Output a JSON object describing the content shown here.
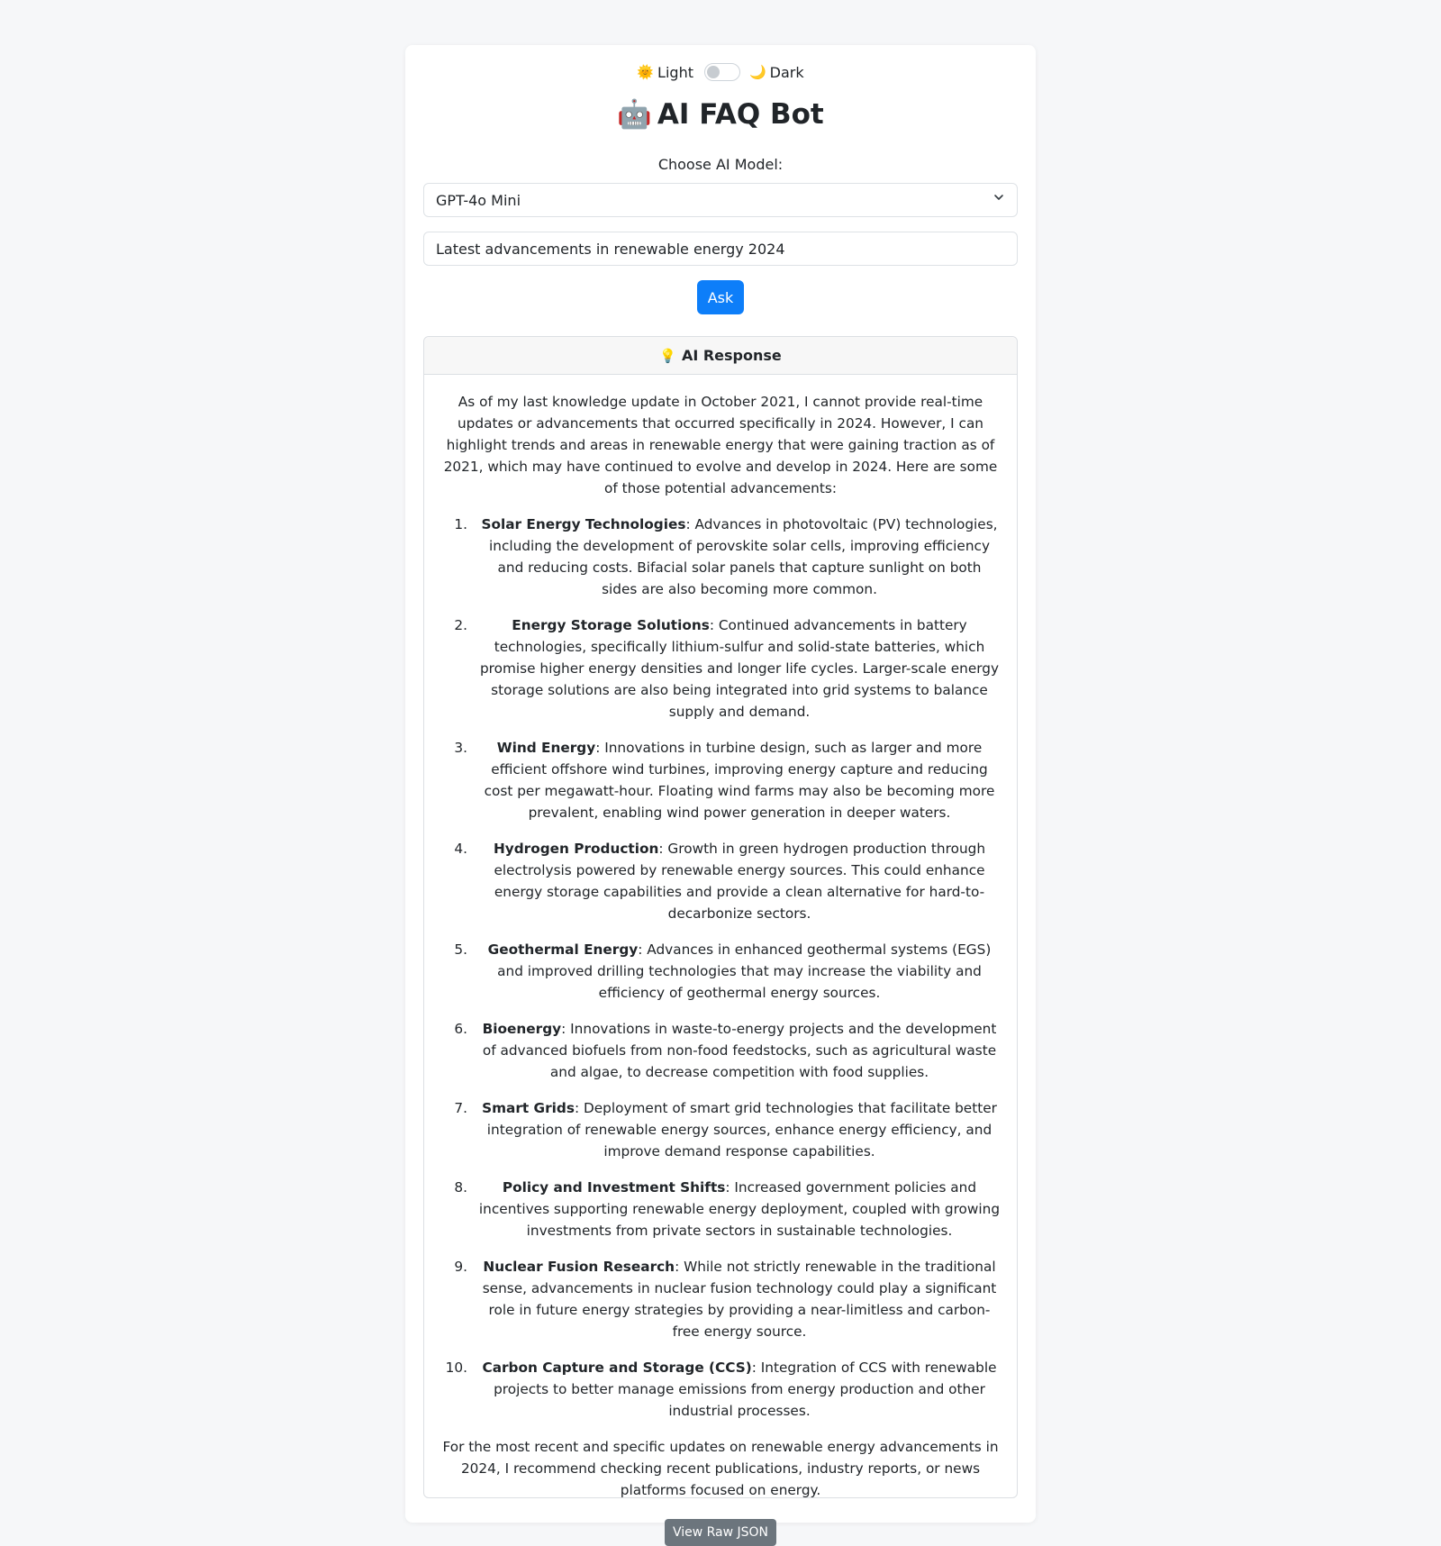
{
  "theme": {
    "light_icon": "🌞",
    "light_label": "Light",
    "dark_icon": "🌙",
    "dark_label": "Dark",
    "is_dark": false
  },
  "header": {
    "icon": "🤖",
    "title": "AI FAQ Bot"
  },
  "model": {
    "label": "Choose AI Model:",
    "selected": "GPT-4o Mini"
  },
  "query": {
    "value": "Latest advancements in renewable energy 2024"
  },
  "ask_label": "Ask",
  "response": {
    "header_icon": "💡",
    "header_label": "AI Response",
    "intro": "As of my last knowledge update in October 2021, I cannot provide real-time updates or advancements that occurred specifically in 2024. However, I can highlight trends and areas in renewable energy that were gaining traction as of 2021, which may have continued to evolve and develop in 2024. Here are some of those potential advancements:",
    "items": [
      {
        "num": "1.",
        "title": "Solar Energy Technologies",
        "text": ": Advances in photovoltaic (PV) technologies, including the development of perovskite solar cells, improving efficiency and reducing costs. Bifacial solar panels that capture sunlight on both sides are also becoming more common."
      },
      {
        "num": "2.",
        "title": "Energy Storage Solutions",
        "text": ": Continued advancements in battery technologies, specifically lithium-sulfur and solid-state batteries, which promise higher energy densities and longer life cycles. Larger-scale energy storage solutions are also being integrated into grid systems to balance supply and demand."
      },
      {
        "num": "3.",
        "title": "Wind Energy",
        "text": ": Innovations in turbine design, such as larger and more efficient offshore wind turbines, improving energy capture and reducing cost per megawatt-hour. Floating wind farms may also be becoming more prevalent, enabling wind power generation in deeper waters."
      },
      {
        "num": "4.",
        "title": "Hydrogen Production",
        "text": ": Growth in green hydrogen production through electrolysis powered by renewable energy sources. This could enhance energy storage capabilities and provide a clean alternative for hard-to-decarbonize sectors."
      },
      {
        "num": "5.",
        "title": "Geothermal Energy",
        "text": ": Advances in enhanced geothermal systems (EGS) and improved drilling technologies that may increase the viability and efficiency of geothermal energy sources."
      },
      {
        "num": "6.",
        "title": "Bioenergy",
        "text": ": Innovations in waste-to-energy projects and the development of advanced biofuels from non-food feedstocks, such as agricultural waste and algae, to decrease competition with food supplies."
      },
      {
        "num": "7.",
        "title": "Smart Grids",
        "text": ": Deployment of smart grid technologies that facilitate better integration of renewable energy sources, enhance energy efficiency, and improve demand response capabilities."
      },
      {
        "num": "8.",
        "title": "Policy and Investment Shifts",
        "text": ": Increased government policies and incentives supporting renewable energy deployment, coupled with growing investments from private sectors in sustainable technologies."
      },
      {
        "num": "9.",
        "title": "Nuclear Fusion Research",
        "text": ": While not strictly renewable in the traditional sense, advancements in nuclear fusion technology could play a significant role in future energy strategies by providing a near-limitless and carbon-free energy source."
      },
      {
        "num": "10.",
        "title": "Carbon Capture and Storage (CCS)",
        "text": ": Integration of CCS with renewable projects to better manage emissions from energy production and other industrial processes."
      }
    ],
    "outro": "For the most recent and specific updates on renewable energy advancements in 2024, I recommend checking recent publications, industry reports, or news platforms focused on energy.",
    "raw_json_label": "View Raw JSON"
  },
  "colors": {
    "primary": "#0d7ef9",
    "secondary": "#6c757d",
    "page_bg": "#f6f7f9"
  }
}
